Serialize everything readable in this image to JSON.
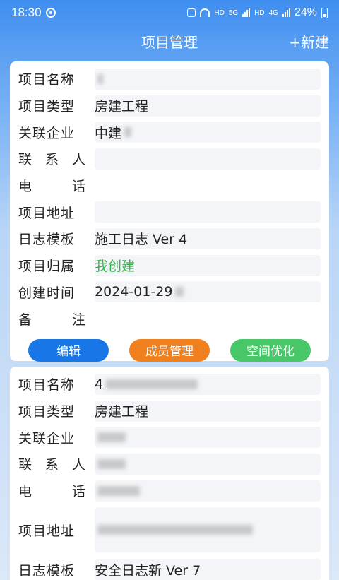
{
  "status_bar": {
    "time": "18:30",
    "hd1": "HD",
    "net": "5G",
    "hd2": "HD",
    "net2": "4G",
    "battery": "24%"
  },
  "header": {
    "title": "项目管理",
    "new_label": "+新建"
  },
  "labels": {
    "name": "项目名称",
    "type": "项目类型",
    "company": "关联企业",
    "contact": [
      "联",
      "系",
      "人"
    ],
    "phone": [
      "电",
      "话"
    ],
    "address": "项目地址",
    "template": "日志模板",
    "owner": "项目归属",
    "created": "创建时间",
    "remark": [
      "备",
      "注"
    ]
  },
  "projects": [
    {
      "name": "",
      "type": "房建工程",
      "company": "中建",
      "contact": "",
      "phone": "",
      "address": "",
      "template": "施工日志 Ver 4",
      "owner": "我创建",
      "created": "2024-01-29",
      "remark": ""
    },
    {
      "name": "4",
      "type": "房建工程",
      "company": "",
      "contact": "",
      "phone": "",
      "address": "",
      "template": "安全日志新 Ver 7"
    }
  ],
  "actions": {
    "edit": "编辑",
    "members": "成员管理",
    "space": "空间优化"
  }
}
